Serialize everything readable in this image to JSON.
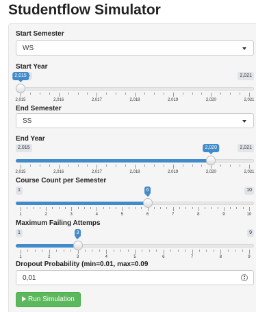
{
  "app": {
    "title": "Studentflow Simulator"
  },
  "start_semester": {
    "label": "Start Semester",
    "value": "WS"
  },
  "start_year": {
    "label": "Start Year",
    "min": 2015,
    "max": 2021,
    "value": 2015,
    "min_text": "2,015",
    "max_text": "2,021",
    "value_text": "2,015",
    "ticks": [
      "2,015",
      "2,016",
      "2,017",
      "2,018",
      "2,019",
      "2,020",
      "2,021"
    ],
    "filled": false
  },
  "end_semester": {
    "label": "End Semester",
    "value": "SS"
  },
  "end_year": {
    "label": "End Year",
    "min": 2015,
    "max": 2021,
    "value": 2020,
    "min_text": "2,015",
    "max_text": "2,021",
    "value_text": "2,020",
    "ticks": [
      "2,015",
      "2,016",
      "2,017",
      "2,018",
      "2,019",
      "2,020",
      "2,021"
    ],
    "filled": true
  },
  "course_count": {
    "label": "Course Count per Semester",
    "min": 1,
    "max": 10,
    "value": 6,
    "min_text": "1",
    "max_text": "10",
    "value_text": "6",
    "ticks": [
      "1",
      "2",
      "3",
      "4",
      "5",
      "6",
      "7",
      "8",
      "9",
      "10"
    ],
    "filled": true
  },
  "max_failing": {
    "label": "Maximum Failing Attemps",
    "min": 1,
    "max": 9,
    "value": 3,
    "min_text": "1",
    "max_text": "9",
    "value_text": "3",
    "ticks": [
      "1",
      "2",
      "3",
      "4",
      "5",
      "6",
      "7",
      "8",
      "9"
    ],
    "filled": true
  },
  "dropout": {
    "label": "Dropout Probability (min=0.01, max=0.09",
    "value": "0,01"
  },
  "run_button": {
    "label": "Run Simulation"
  },
  "colors": {
    "accent": "#428bca",
    "button": "#5cb85c",
    "panel": "#f5f5f5"
  }
}
